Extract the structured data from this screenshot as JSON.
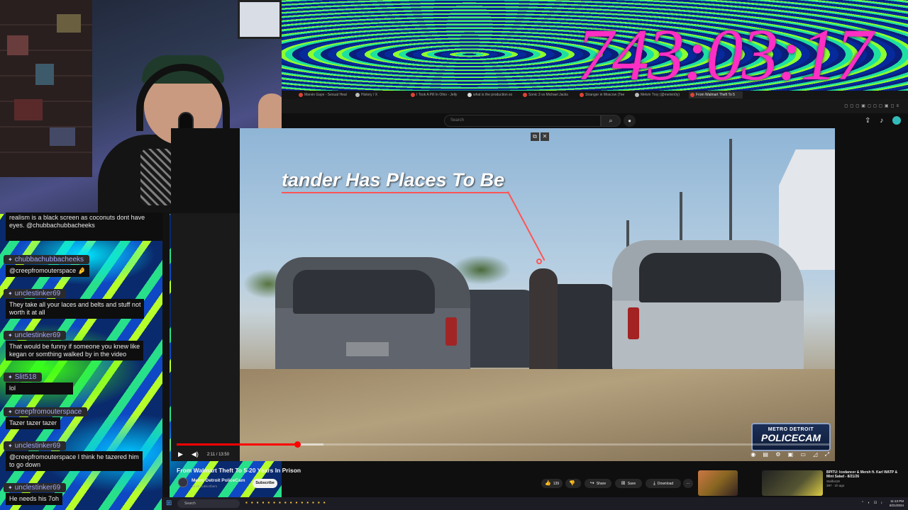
{
  "stream": {
    "timer": "743:03:17"
  },
  "chat": {
    "top_message_lines": [
      "realism is a black screen as coconuts dont have",
      "eyes. @chubbachubbacheeks"
    ],
    "messages": [
      {
        "user": "chubbachubbacheeks",
        "lines": [
          "@creepfromouterspace 🤌"
        ]
      },
      {
        "user": "unclestinker69",
        "lines": [
          "They take all your laces and belts and stuff not",
          "worth it at all"
        ]
      },
      {
        "user": "unclestinker69",
        "lines": [
          "That would be funny if someone you knew like",
          "kegan or somthing walked by in the video"
        ]
      },
      {
        "user": "Slit518",
        "lines": [
          "lol"
        ]
      },
      {
        "user": "creepfromouterspace",
        "lines": [
          "Tazer tazer tazer"
        ]
      },
      {
        "user": "unclestinker69",
        "lines": [
          "@creepfromouterspace I think he tazered him",
          "to go down"
        ]
      },
      {
        "user": "unclestinker69",
        "lines": [
          "He needs his 7oh"
        ]
      }
    ]
  },
  "browser": {
    "tabs": [
      {
        "label": "Marvin Gaye - Sexual Heal",
        "icon": "red"
      },
      {
        "label": "History / X",
        "icon": "x"
      },
      {
        "label": "I Took A Pill In Ohio - Jelly",
        "icon": "red"
      },
      {
        "label": "what is the production so",
        "icon": "p"
      },
      {
        "label": "Sonic 3 vs Michael Jacks",
        "icon": "red"
      },
      {
        "label": "Stranger in Moscow (Tee",
        "icon": "red"
      },
      {
        "label": "Melvin Troy (@melvin0y)",
        "icon": "x"
      },
      {
        "label": "From Walmart Theft To 5",
        "icon": "red",
        "active": true
      }
    ]
  },
  "youtube": {
    "search_placeholder": "Search",
    "video_overlay_text": "tander Has Places To Be",
    "logo_line1": "METRO DETROIT",
    "logo_line2": "POLICECAM",
    "time_display": "2:11 / 13:50",
    "progress_fraction": 0.185,
    "buffer_fraction": 0.225,
    "title": "From Walmart Theft To 5-20 Years In Prison",
    "channel_name": "Metro Detroit PoliceCam",
    "channel_subs": "16.2K subscribers",
    "subscribe_label": "Subscribe",
    "like_count": "139",
    "share_label": "Share",
    "save_label": "Save",
    "download_label": "Download",
    "more_label": "...",
    "suggested": {
      "title": "BPITU: Icedancer & Mersh ft. Karl WATP & Mint Salad - 8/21/26",
      "channel": "Stalfos19",
      "meta": "397 · 1h ago"
    }
  },
  "taskbar": {
    "search_placeholder": "Search",
    "time": "11:13 PM",
    "date": "8/21/2024"
  },
  "colors": {
    "timer": "#ff2ec4",
    "progress": "#ff0000",
    "chat_name": "#a3a8ff"
  }
}
